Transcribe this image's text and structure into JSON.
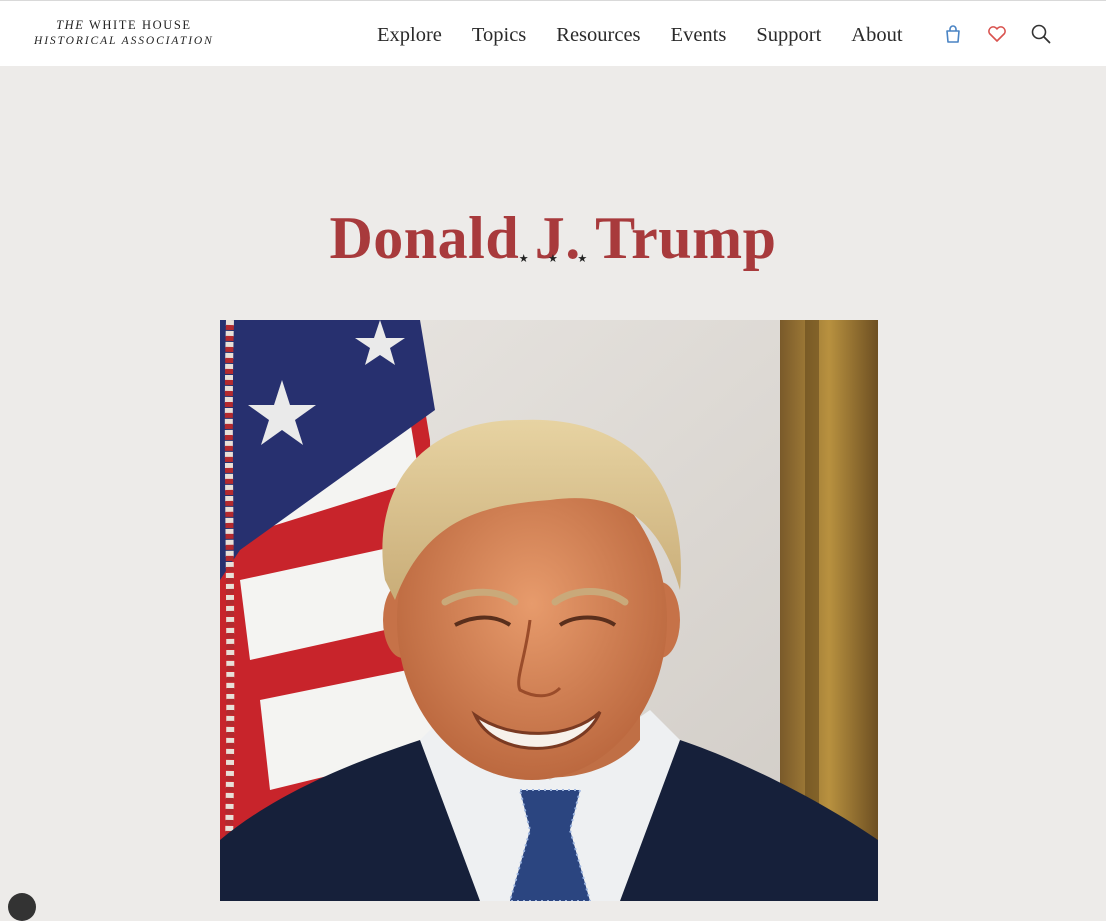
{
  "header": {
    "logo": {
      "line1_prefix": "THE",
      "line1_rest": "WHITE HOUSE",
      "line2": "HISTORICAL ASSOCIATION"
    },
    "nav": [
      "Explore",
      "Topics",
      "Resources",
      "Events",
      "Support",
      "About"
    ],
    "icons": {
      "cart": "shopping-bag-icon",
      "wishlist": "heart-icon",
      "search": "search-icon"
    }
  },
  "main": {
    "title": "Donald J. Trump",
    "divider": "★ ★ ★"
  },
  "colors": {
    "title": "#a83a3c",
    "background": "#edebe9",
    "header_bg": "#ffffff",
    "cart_icon": "#4a84c4",
    "heart_icon": "#d9534f"
  }
}
